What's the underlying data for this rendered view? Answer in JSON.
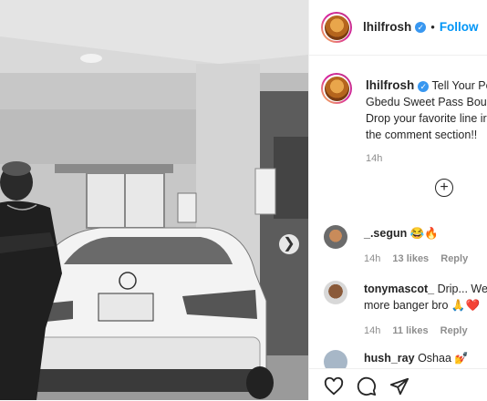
{
  "post": {
    "username": "lhilfrosh",
    "verified_mark": "✓",
    "dot": "•",
    "follow_label": "Follow",
    "caption_lines": [
      "Tell Your Peo",
      "Gbedu Sweet Pass Bourn",
      "Drop your favorite line ir",
      "the comment section!!"
    ],
    "caption_time": "14h",
    "photo_icon": "person-with-car-photo",
    "next_icon": "chevron-right-icon"
  },
  "comments": [
    {
      "username": "_.segun",
      "text": "😂🔥",
      "time": "14h",
      "likes": "13 likes",
      "reply": "Reply"
    },
    {
      "username": "tonymascot_",
      "text": "Drip... We r",
      "text2": "more banger bro 🙏❤️",
      "time": "14h",
      "likes": "11 likes",
      "reply": "Reply"
    },
    {
      "username": "hush_ray",
      "text": "Oshaa 💅"
    }
  ],
  "actions": {
    "icons": [
      "heart-icon",
      "comment-icon",
      "share-icon"
    ]
  },
  "colors": {
    "accent": "#0095f6",
    "verified": "#3897f0",
    "like_red": "#ed4956"
  }
}
